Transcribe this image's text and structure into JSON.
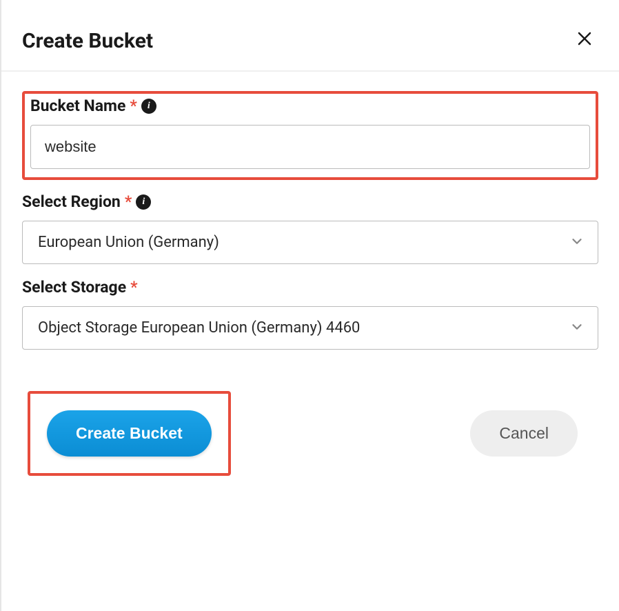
{
  "modal": {
    "title": "Create Bucket",
    "fields": {
      "bucket_name": {
        "label": "Bucket Name",
        "required_marker": "*",
        "value": "website"
      },
      "region": {
        "label": "Select Region",
        "required_marker": "*",
        "selected": "European Union (Germany)"
      },
      "storage": {
        "label": "Select Storage",
        "required_marker": "*",
        "selected": "Object Storage European Union (Germany) 4460"
      }
    },
    "buttons": {
      "create": "Create Bucket",
      "cancel": "Cancel"
    }
  }
}
